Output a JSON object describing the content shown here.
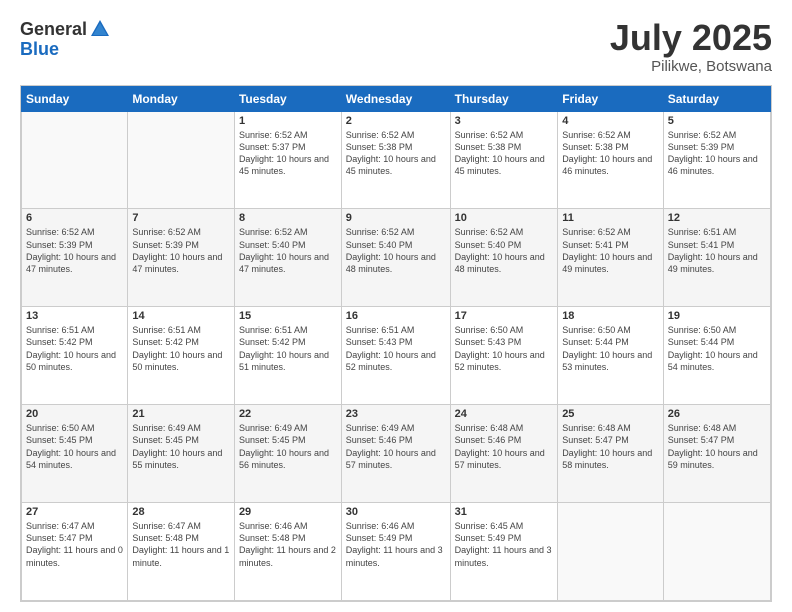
{
  "header": {
    "logo_general": "General",
    "logo_blue": "Blue",
    "title": "July 2025",
    "subtitle": "Pilikwe, Botswana"
  },
  "calendar": {
    "days_of_week": [
      "Sunday",
      "Monday",
      "Tuesday",
      "Wednesday",
      "Thursday",
      "Friday",
      "Saturday"
    ],
    "weeks": [
      [
        {
          "day": "",
          "info": ""
        },
        {
          "day": "",
          "info": ""
        },
        {
          "day": "1",
          "info": "Sunrise: 6:52 AM\nSunset: 5:37 PM\nDaylight: 10 hours and 45 minutes."
        },
        {
          "day": "2",
          "info": "Sunrise: 6:52 AM\nSunset: 5:38 PM\nDaylight: 10 hours and 45 minutes."
        },
        {
          "day": "3",
          "info": "Sunrise: 6:52 AM\nSunset: 5:38 PM\nDaylight: 10 hours and 45 minutes."
        },
        {
          "day": "4",
          "info": "Sunrise: 6:52 AM\nSunset: 5:38 PM\nDaylight: 10 hours and 46 minutes."
        },
        {
          "day": "5",
          "info": "Sunrise: 6:52 AM\nSunset: 5:39 PM\nDaylight: 10 hours and 46 minutes."
        }
      ],
      [
        {
          "day": "6",
          "info": "Sunrise: 6:52 AM\nSunset: 5:39 PM\nDaylight: 10 hours and 47 minutes."
        },
        {
          "day": "7",
          "info": "Sunrise: 6:52 AM\nSunset: 5:39 PM\nDaylight: 10 hours and 47 minutes."
        },
        {
          "day": "8",
          "info": "Sunrise: 6:52 AM\nSunset: 5:40 PM\nDaylight: 10 hours and 47 minutes."
        },
        {
          "day": "9",
          "info": "Sunrise: 6:52 AM\nSunset: 5:40 PM\nDaylight: 10 hours and 48 minutes."
        },
        {
          "day": "10",
          "info": "Sunrise: 6:52 AM\nSunset: 5:40 PM\nDaylight: 10 hours and 48 minutes."
        },
        {
          "day": "11",
          "info": "Sunrise: 6:52 AM\nSunset: 5:41 PM\nDaylight: 10 hours and 49 minutes."
        },
        {
          "day": "12",
          "info": "Sunrise: 6:51 AM\nSunset: 5:41 PM\nDaylight: 10 hours and 49 minutes."
        }
      ],
      [
        {
          "day": "13",
          "info": "Sunrise: 6:51 AM\nSunset: 5:42 PM\nDaylight: 10 hours and 50 minutes."
        },
        {
          "day": "14",
          "info": "Sunrise: 6:51 AM\nSunset: 5:42 PM\nDaylight: 10 hours and 50 minutes."
        },
        {
          "day": "15",
          "info": "Sunrise: 6:51 AM\nSunset: 5:42 PM\nDaylight: 10 hours and 51 minutes."
        },
        {
          "day": "16",
          "info": "Sunrise: 6:51 AM\nSunset: 5:43 PM\nDaylight: 10 hours and 52 minutes."
        },
        {
          "day": "17",
          "info": "Sunrise: 6:50 AM\nSunset: 5:43 PM\nDaylight: 10 hours and 52 minutes."
        },
        {
          "day": "18",
          "info": "Sunrise: 6:50 AM\nSunset: 5:44 PM\nDaylight: 10 hours and 53 minutes."
        },
        {
          "day": "19",
          "info": "Sunrise: 6:50 AM\nSunset: 5:44 PM\nDaylight: 10 hours and 54 minutes."
        }
      ],
      [
        {
          "day": "20",
          "info": "Sunrise: 6:50 AM\nSunset: 5:45 PM\nDaylight: 10 hours and 54 minutes."
        },
        {
          "day": "21",
          "info": "Sunrise: 6:49 AM\nSunset: 5:45 PM\nDaylight: 10 hours and 55 minutes."
        },
        {
          "day": "22",
          "info": "Sunrise: 6:49 AM\nSunset: 5:45 PM\nDaylight: 10 hours and 56 minutes."
        },
        {
          "day": "23",
          "info": "Sunrise: 6:49 AM\nSunset: 5:46 PM\nDaylight: 10 hours and 57 minutes."
        },
        {
          "day": "24",
          "info": "Sunrise: 6:48 AM\nSunset: 5:46 PM\nDaylight: 10 hours and 57 minutes."
        },
        {
          "day": "25",
          "info": "Sunrise: 6:48 AM\nSunset: 5:47 PM\nDaylight: 10 hours and 58 minutes."
        },
        {
          "day": "26",
          "info": "Sunrise: 6:48 AM\nSunset: 5:47 PM\nDaylight: 10 hours and 59 minutes."
        }
      ],
      [
        {
          "day": "27",
          "info": "Sunrise: 6:47 AM\nSunset: 5:47 PM\nDaylight: 11 hours and 0 minutes."
        },
        {
          "day": "28",
          "info": "Sunrise: 6:47 AM\nSunset: 5:48 PM\nDaylight: 11 hours and 1 minute."
        },
        {
          "day": "29",
          "info": "Sunrise: 6:46 AM\nSunset: 5:48 PM\nDaylight: 11 hours and 2 minutes."
        },
        {
          "day": "30",
          "info": "Sunrise: 6:46 AM\nSunset: 5:49 PM\nDaylight: 11 hours and 3 minutes."
        },
        {
          "day": "31",
          "info": "Sunrise: 6:45 AM\nSunset: 5:49 PM\nDaylight: 11 hours and 3 minutes."
        },
        {
          "day": "",
          "info": ""
        },
        {
          "day": "",
          "info": ""
        }
      ]
    ]
  }
}
